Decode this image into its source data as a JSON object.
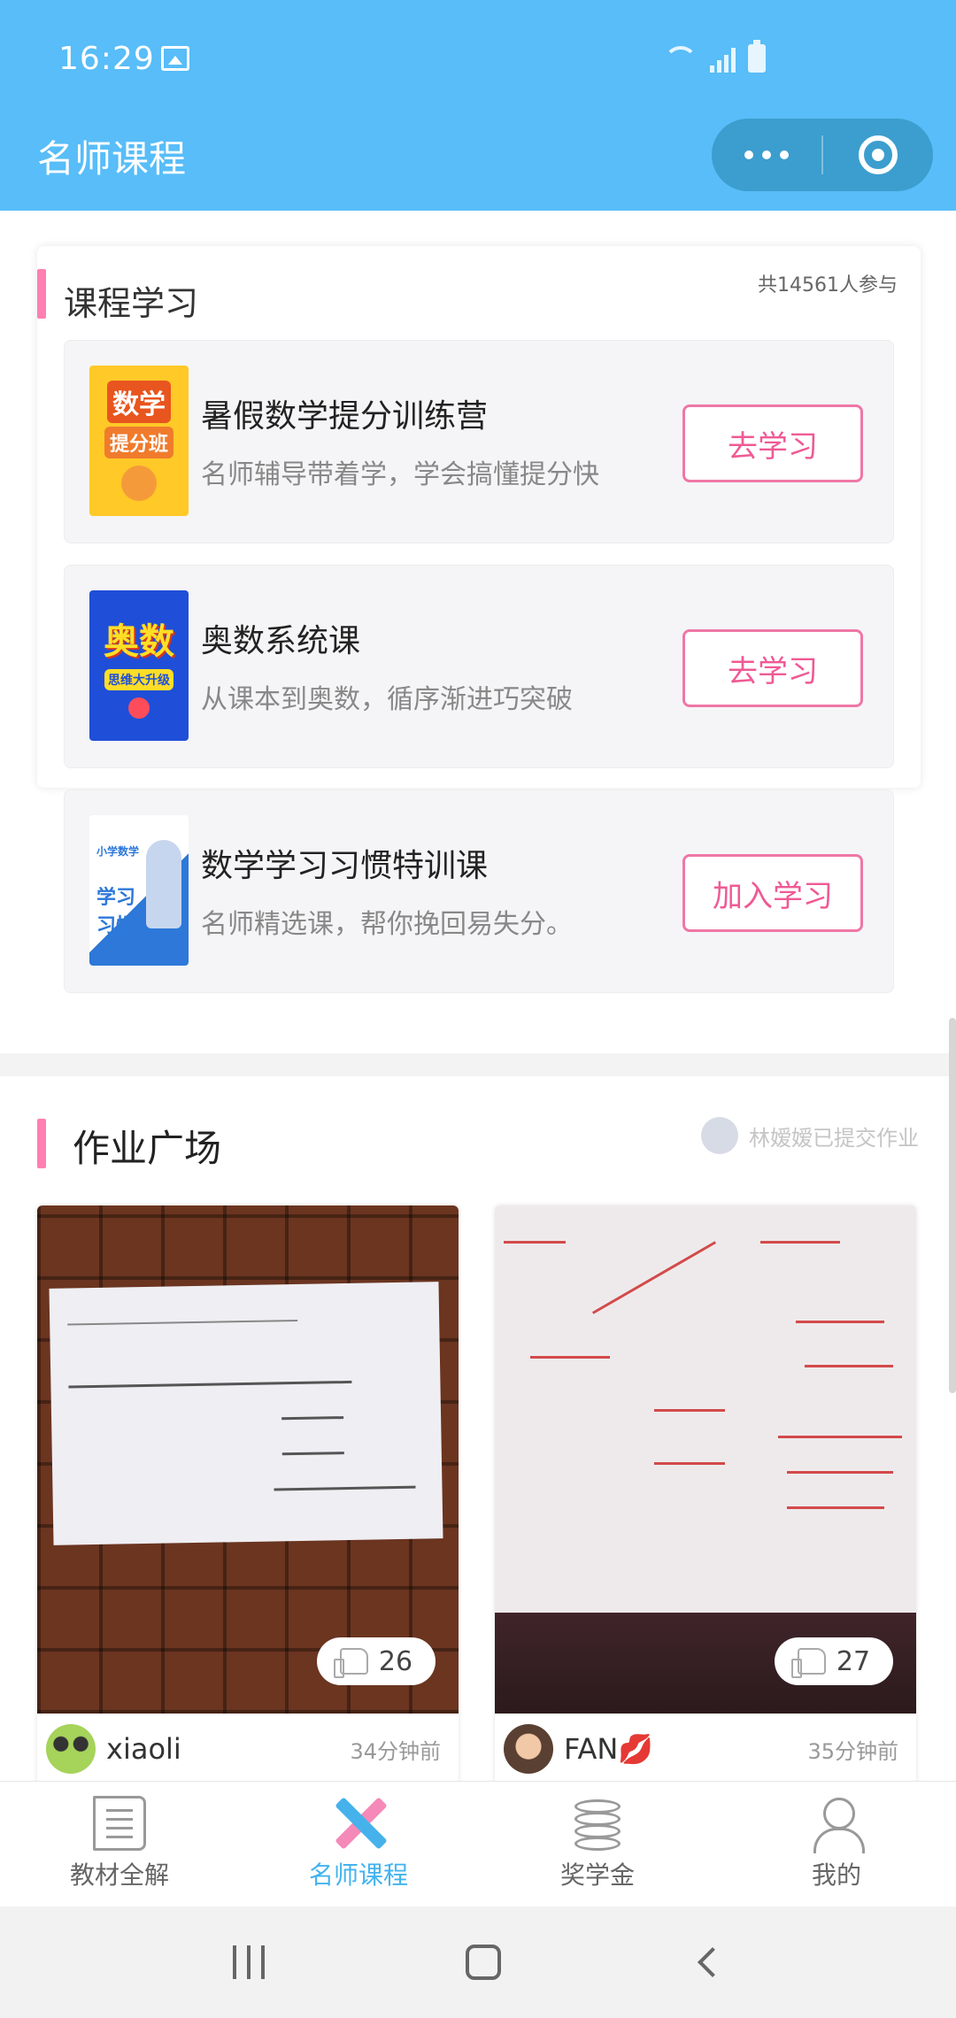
{
  "status_bar": {
    "time": "16:29"
  },
  "header": {
    "title": "名师课程"
  },
  "courses": {
    "title": "课程学习",
    "participants": "共14561人参与",
    "items": [
      {
        "name": "暑假数学提分训练营",
        "desc": "名师辅导带着学，学会搞懂提分快",
        "button": "去学习",
        "cover_lines": [
          "数学",
          "提分班"
        ]
      },
      {
        "name": "奥数系统课",
        "desc": "从课本到奥数，循序渐进巧突破",
        "button": "去学习",
        "cover_lines": [
          "奥数",
          "思维大升级"
        ]
      },
      {
        "name": "数学学习习惯特训课",
        "desc": "名师精选课，帮你挽回易失分。",
        "button": "加入学习",
        "cover_lines": [
          "小学数学",
          "学习",
          "习惯"
        ]
      }
    ]
  },
  "homework": {
    "title": "作业广场",
    "notice": "林嫒嫒已提交作业",
    "posts": [
      {
        "user": "xiaoli",
        "time": "34分钟前",
        "likes": "26"
      },
      {
        "user": "FAN💋",
        "time": "35分钟前",
        "likes": "27"
      }
    ]
  },
  "tabs": [
    {
      "label": "教材全解",
      "icon": "book-icon"
    },
    {
      "label": "名师课程",
      "icon": "pencil-ruler-icon",
      "active": true
    },
    {
      "label": "奖学金",
      "icon": "coins-icon"
    },
    {
      "label": "我的",
      "icon": "person-icon"
    }
  ],
  "colors": {
    "header": "#58bdf8",
    "accent_pink": "#ef77a6",
    "tab_active": "#42b3ee"
  }
}
